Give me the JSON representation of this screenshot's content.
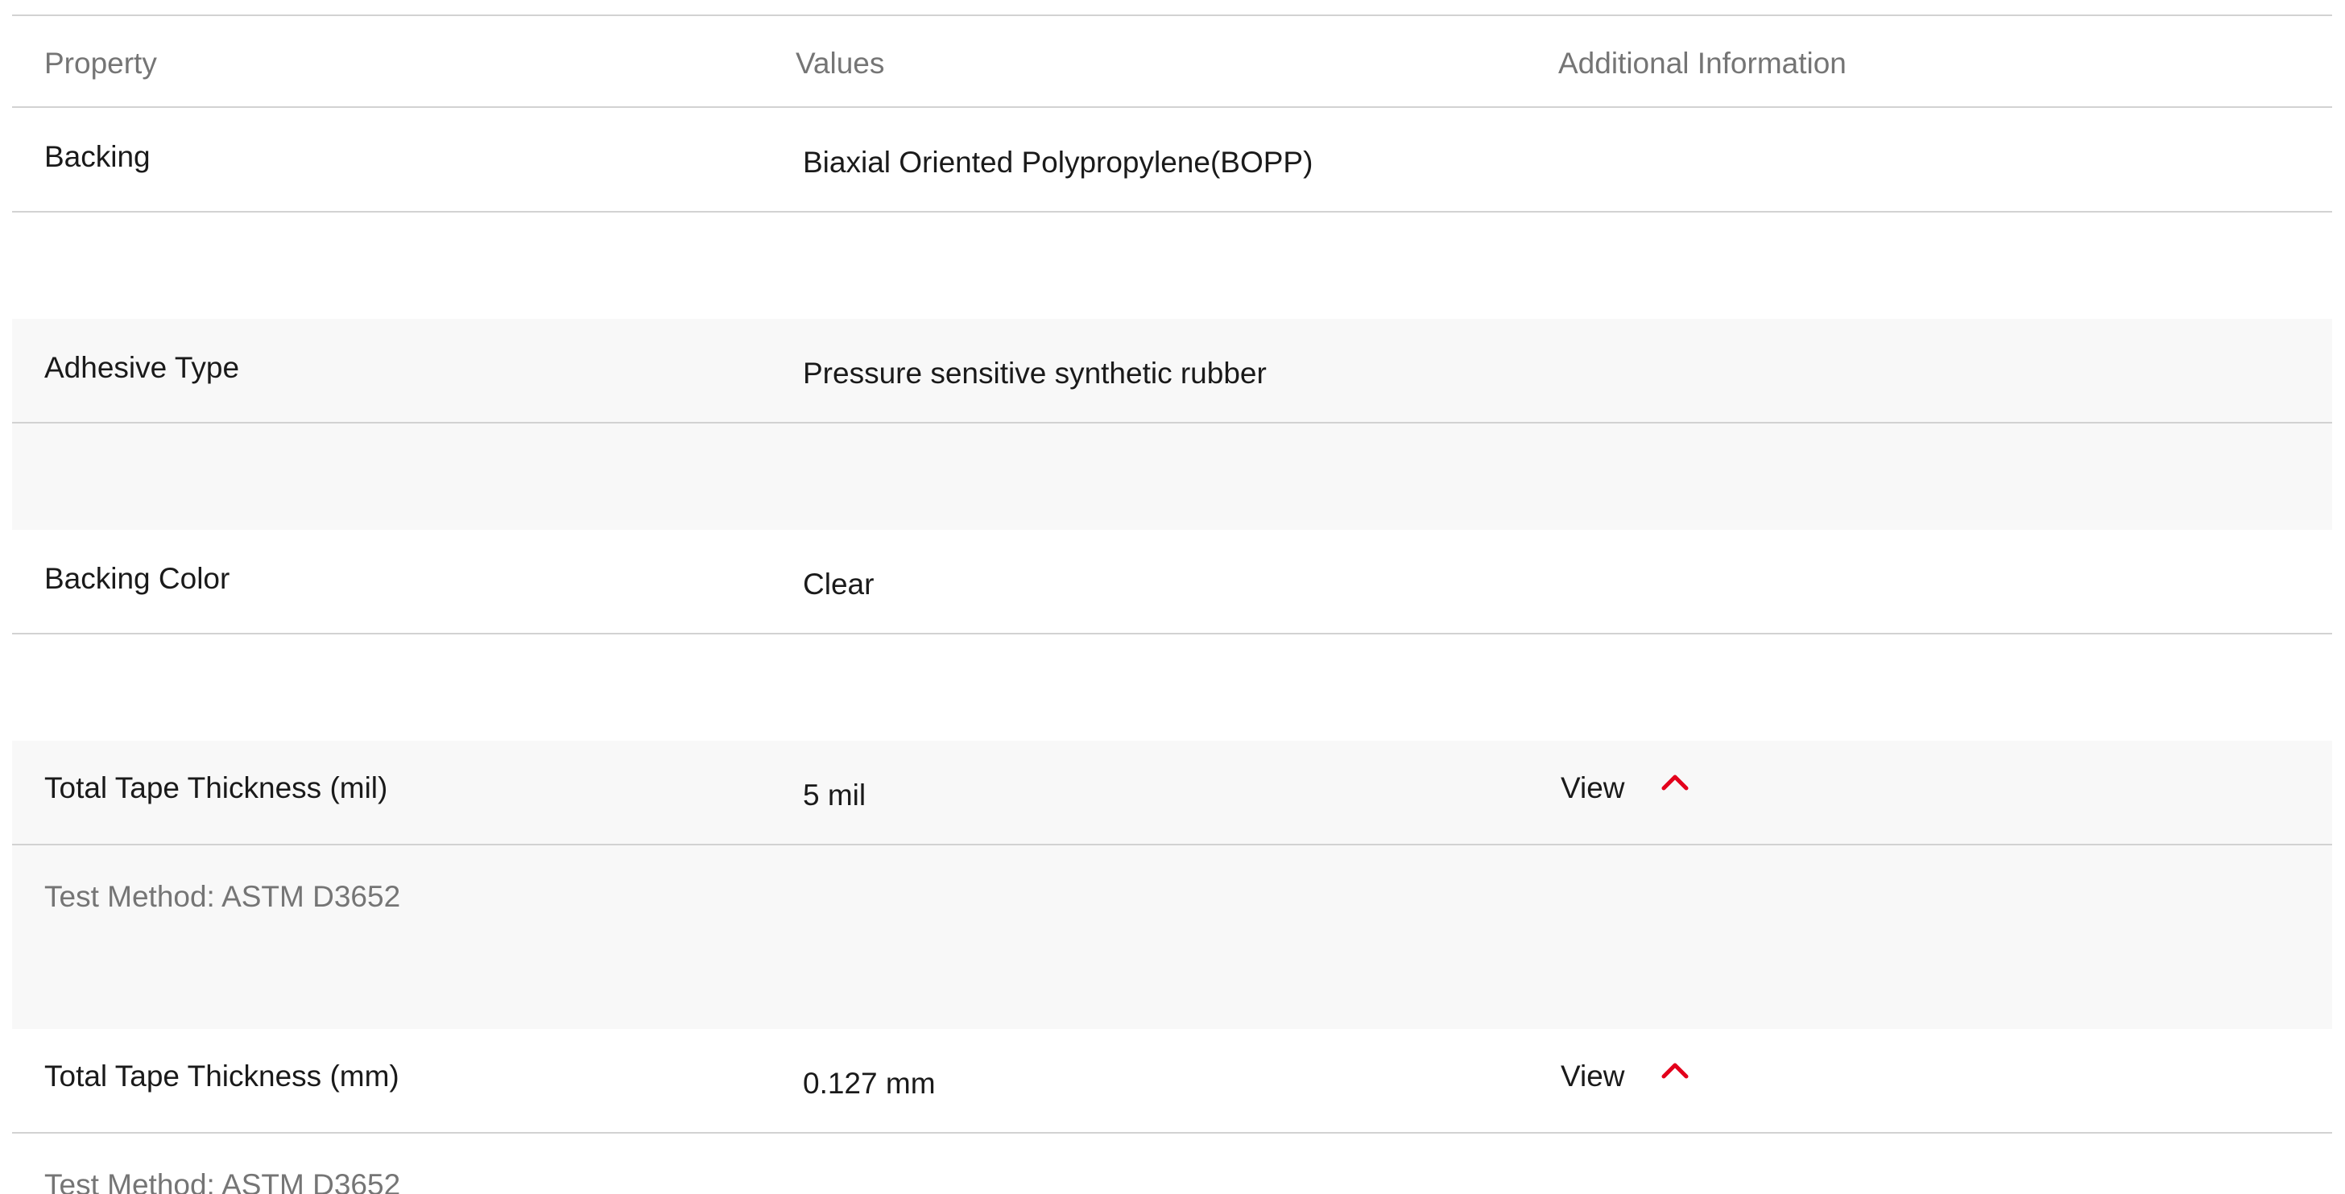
{
  "header": {
    "property": "Property",
    "values": "Values",
    "additional_information": "Additional Information"
  },
  "rows": [
    {
      "property": "Backing",
      "value": "Biaxial Oriented Polypropylene(BOPP)"
    },
    {
      "property": "Adhesive Type",
      "value": "Pressure sensitive synthetic rubber"
    },
    {
      "property": "Backing Color",
      "value": "Clear"
    },
    {
      "property": "Total Tape Thickness (mil)",
      "value": "5 mil",
      "additional_label": "View",
      "test_method": "Test Method: ASTM D3652"
    },
    {
      "property": "Total Tape Thickness (mm)",
      "value": "0.127 mm",
      "additional_label": "View",
      "test_method": "Test Method: ASTM D3652"
    }
  ],
  "icons": {
    "expand_toggle": "chevron-up-icon"
  },
  "colors": {
    "accent": "#e3001b",
    "border": "#d2d2d2",
    "muted_text": "#757575",
    "row_alt_bg": "#f8f8f8"
  }
}
